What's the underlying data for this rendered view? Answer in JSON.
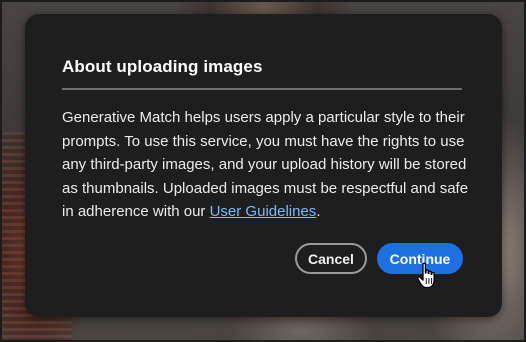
{
  "dialog": {
    "title": "About uploading images",
    "body_text": "Generative Match helps users apply a particular style to their prompts. To use this service, you must have the rights to use any third-party images, and your upload history will be stored as thumbnails. Uploaded images must be respectful and safe in adherence with our ",
    "link_text": "User Guidelines",
    "body_end": ".",
    "cancel_label": "Cancel",
    "continue_label": "Continue"
  },
  "colors": {
    "dialog_bg": "#1e1e1e",
    "primary_button": "#1e6fe0",
    "link": "#7db8ff"
  },
  "icons": {
    "cursor": "hand-pointer-icon"
  }
}
